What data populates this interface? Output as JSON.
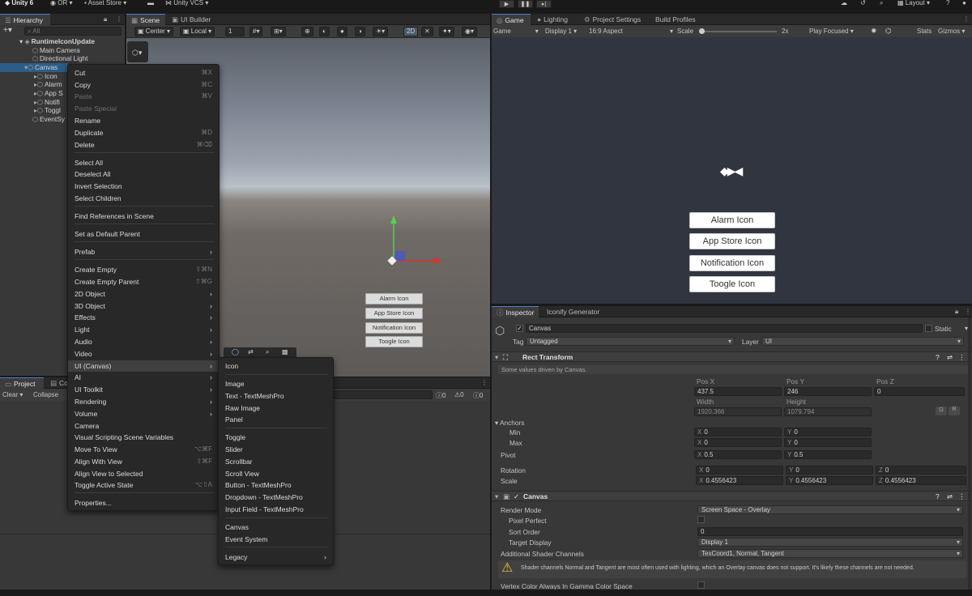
{
  "topbar": {
    "account": "Unity 6",
    "org": "OR",
    "asset_store": "Asset Store",
    "vcs": "Unity VCS",
    "layout": "Layout",
    "play_icon": "play-icon",
    "pause_icon": "pause-icon",
    "step_icon": "step-icon"
  },
  "hierarchy": {
    "tab": "Hierarchy",
    "search_placeholder": "All",
    "items": [
      "RuntimeIconUpdate",
      "Main Camera",
      "Directional Light",
      "Canvas",
      "Icon",
      "Alarm",
      "App S",
      "Notifi",
      "Toggl",
      "EventSy"
    ]
  },
  "scene": {
    "tabs": [
      "Scene",
      "UI Builder"
    ],
    "pivot": "Center",
    "space": "Local",
    "grid_value": "1",
    "mode_2d": "2D",
    "buttons": [
      "Alarm Icon",
      "App Store Icon",
      "Notification Icon",
      "Toogle Icon"
    ]
  },
  "game": {
    "tabs": [
      "Game",
      "Lighting",
      "Project Settings",
      "Build Profiles"
    ],
    "mode": "Game",
    "display": "Display 1",
    "aspect": "16:9 Aspect",
    "scale_label": "Scale",
    "scale_value": "2x",
    "play_focused": "Play Focused",
    "stats": "Stats",
    "gizmos": "Gizmos",
    "buttons": [
      "Alarm Icon",
      "App Store Icon",
      "Notification Icon",
      "Toogle Icon"
    ]
  },
  "project": {
    "tabs": [
      "Project",
      "Co"
    ],
    "clear": "Clear",
    "collapse": "Collapse",
    "counts": [
      "0",
      "0",
      "0"
    ]
  },
  "inspector": {
    "tabs": [
      "Inspector",
      "Iconify Generator"
    ],
    "object_name": "Canvas",
    "static_label": "Static",
    "tag_label": "Tag",
    "tag_value": "Untagged",
    "layer_label": "Layer",
    "layer_value": "UI",
    "rect_transform": {
      "title": "Rect Transform",
      "note": "Some values driven by Canvas.",
      "pos_x_label": "Pos X",
      "pos_x": "437.5",
      "pos_y_label": "Pos Y",
      "pos_y": "246",
      "pos_z_label": "Pos Z",
      "pos_z": "0",
      "width_label": "Width",
      "width": "1920.366",
      "height_label": "Height",
      "height": "1079.794",
      "anchors_label": "Anchors",
      "min_label": "Min",
      "min_x": "0",
      "min_y": "0",
      "max_label": "Max",
      "max_x": "0",
      "max_y": "0",
      "pivot_label": "Pivot",
      "pivot_x": "0.5",
      "pivot_y": "0.5",
      "rotation_label": "Rotation",
      "rot_x": "0",
      "rot_y": "0",
      "rot_z": "0",
      "scale_label": "Scale",
      "scale_x": "0.4556423",
      "scale_y": "0.4556423",
      "scale_z": "0.4556423",
      "r_button": "R"
    },
    "canvas": {
      "title": "Canvas",
      "render_mode_label": "Render Mode",
      "render_mode": "Screen Space - Overlay",
      "pixel_perfect_label": "Pixel Perfect",
      "sort_order_label": "Sort Order",
      "sort_order": "0",
      "target_display_label": "Target Display",
      "target_display": "Display 1",
      "shader_channels_label": "Additional Shader Channels",
      "shader_channels": "TexCoord1, Normal, Tangent",
      "warning": "Shader channels Normal and Tangent are most often used with lighting, which an Overlay canvas does not support. It's likely these channels are not needed.",
      "vertex_color_label": "Vertex Color Always In Gamma Color Space"
    }
  },
  "context_menu": {
    "items": [
      {
        "label": "Cut",
        "shortcut": "⌘X"
      },
      {
        "label": "Copy",
        "shortcut": "⌘C"
      },
      {
        "label": "Paste",
        "shortcut": "⌘V",
        "disabled": true
      },
      {
        "label": "Paste Special",
        "disabled": true
      },
      {
        "label": "Rename"
      },
      {
        "label": "Duplicate",
        "shortcut": "⌘D"
      },
      {
        "label": "Delete",
        "shortcut": "⌘⌫"
      },
      {
        "label": "Select All"
      },
      {
        "label": "Deselect All"
      },
      {
        "label": "Invert Selection"
      },
      {
        "label": "Select Children"
      },
      {
        "label": "Find References in Scene"
      },
      {
        "label": "Set as Default Parent"
      },
      {
        "label": "Prefab"
      },
      {
        "label": "Create Empty",
        "shortcut": "⇧⌘N"
      },
      {
        "label": "Create Empty Parent",
        "shortcut": "⇧⌘G"
      },
      {
        "label": "2D Object"
      },
      {
        "label": "3D Object"
      },
      {
        "label": "Effects"
      },
      {
        "label": "Light"
      },
      {
        "label": "Audio"
      },
      {
        "label": "Video"
      },
      {
        "label": "UI (Canvas)"
      },
      {
        "label": "AI"
      },
      {
        "label": "UI Toolkit"
      },
      {
        "label": "Rendering"
      },
      {
        "label": "Volume"
      },
      {
        "label": "Camera"
      },
      {
        "label": "Visual Scripting Scene Variables"
      },
      {
        "label": "Move To View",
        "shortcut": "⌥⌘F"
      },
      {
        "label": "Align With View",
        "shortcut": "⇧⌘F"
      },
      {
        "label": "Align View to Selected"
      },
      {
        "label": "Toggle Active State",
        "shortcut": "⌥⇧A"
      },
      {
        "label": "Properties..."
      }
    ]
  },
  "submenu": {
    "items": [
      "Icon",
      "Image",
      "Text - TextMeshPro",
      "Raw Image",
      "Panel",
      "Toggle",
      "Slider",
      "Scrollbar",
      "Scroll View",
      "Button - TextMeshPro",
      "Dropdown - TextMeshPro",
      "Input Field - TextMeshPro",
      "Canvas",
      "Event System",
      "Legacy"
    ]
  },
  "colors": {
    "selection": "#2c5d87",
    "accent": "#4a7fd0",
    "warning": "#f2c230"
  }
}
